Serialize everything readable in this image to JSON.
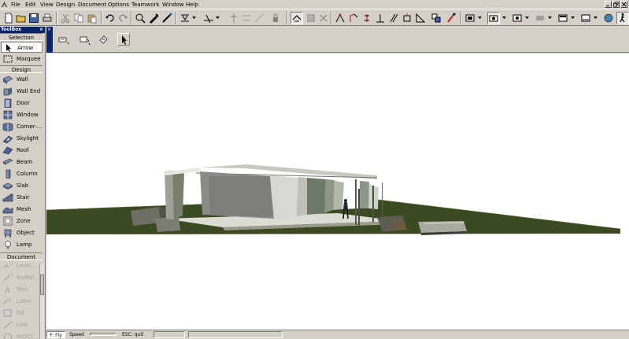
{
  "menu": [
    "File",
    "Edit",
    "View",
    "Design",
    "Document",
    "Options",
    "Teamwork",
    "Window",
    "Help"
  ],
  "toolbar_icons": [
    "new-icon",
    "open-icon",
    "save-icon",
    "print-icon",
    "cut-icon",
    "copy-icon",
    "paste-icon",
    "undo-icon",
    "redo-icon",
    "magic-wand-icon",
    "pick-up-icon",
    "inject-icon",
    "gravity-icon",
    "trim-icon",
    "split-icon",
    "lock-icon",
    "ruler-icon",
    "grid-icon",
    "snap-icon",
    "elevation-icon",
    "arc-icon",
    "align-icon",
    "perpendicular-icon",
    "parallel-icon",
    "guide-icon",
    "layer-icon",
    "camera-icon",
    "window-icon",
    "navigator-icon",
    "render-icon",
    "globe-icon",
    "walk-icon"
  ],
  "toolbox": {
    "title": "ToolBox",
    "sections": {
      "selection": "Selection",
      "design": "Design",
      "document": "Document"
    },
    "tools": {
      "arrow": "Arrow",
      "marquee": "Marquee",
      "wall": "Wall",
      "wall_end": "Wall End",
      "door": "Door",
      "window": "Window",
      "corner": "Corner-...",
      "skylight": "Skylight",
      "roof": "Roof",
      "beam": "Beam",
      "column": "Column",
      "slab": "Slab",
      "stair": "Stair",
      "mesh": "Mesh",
      "zone": "Zone",
      "object": "Object",
      "lamp": "Lamp",
      "level": "Level ...",
      "radial": "Radial...",
      "text": "Text",
      "label": "Label",
      "fill": "Fill",
      "line": "Line",
      "arc": "Arc/Ci..."
    }
  },
  "statusbar": {
    "fly": "F: Fly",
    "speed": "Speed",
    "esc": "ESC: quit"
  }
}
